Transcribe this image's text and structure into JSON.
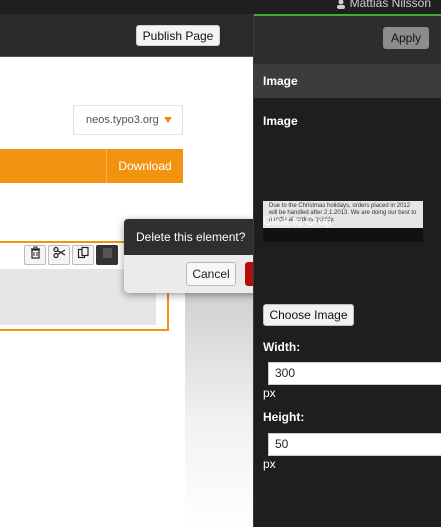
{
  "topbar": {
    "user_name": "Mattias Nilsson"
  },
  "content_bar": {
    "publish_label": "Publish Page"
  },
  "page": {
    "site_selector": "neos.typo3.org",
    "download_label": "Download"
  },
  "delete_dialog": {
    "question": "Delete this element?",
    "cancel_label": "Cancel"
  },
  "inspector": {
    "apply_label": "Apply",
    "section_title": "Image",
    "image_label": "Image",
    "thumbnail_text": "Due to the Christmas holidays, orders placed in 2012 will be handled after 2.1.2013. We are doing our best to handle all orders quickly.",
    "crop_label": "Click to Crop",
    "choose_image_label": "Choose Image",
    "width_label": "Width:",
    "width_value": "300",
    "width_unit": "px",
    "height_label": "Height:",
    "height_value": "50",
    "height_unit": "px"
  },
  "colors": {
    "accent": "#f29211",
    "danger": "#b30f0f",
    "panel": "#1e1e1e"
  }
}
